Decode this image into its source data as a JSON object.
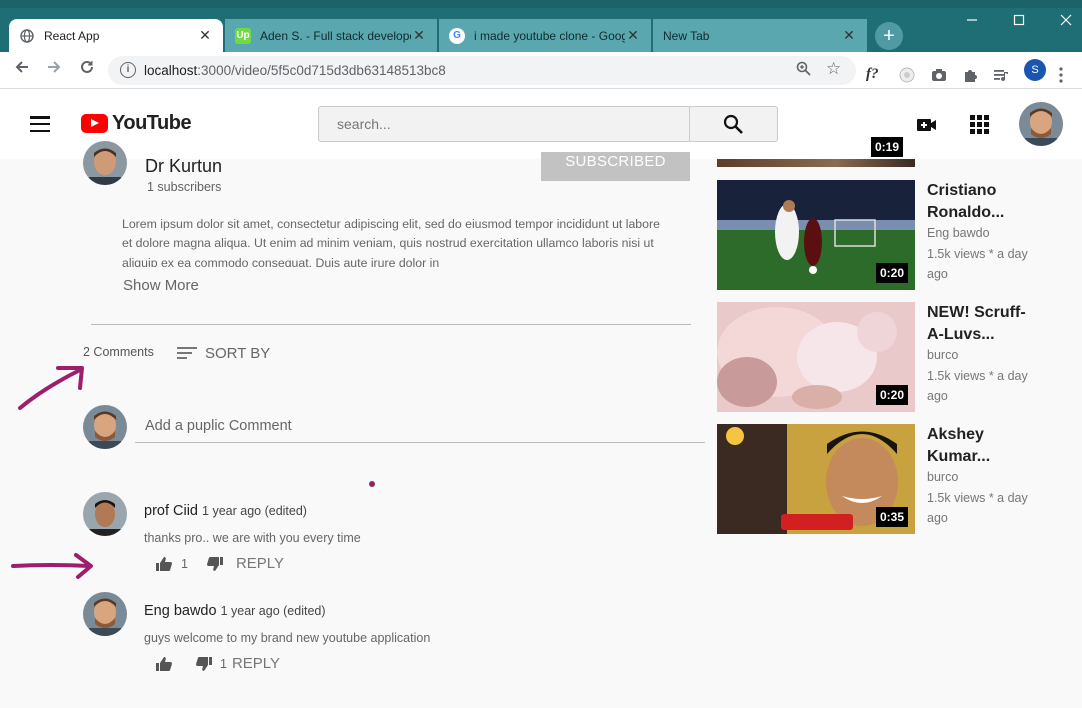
{
  "browser": {
    "tabs": [
      {
        "title": "React App",
        "close": "✕",
        "icon": "globe-icon"
      },
      {
        "title": "Aden S. - Full stack developer",
        "close": "✕",
        "icon": "upwork-icon",
        "badge": "Up"
      },
      {
        "title": "i made youtube clone - Google",
        "close": "✕",
        "icon": "google-icon",
        "badge": "G"
      },
      {
        "title": "New Tab",
        "close": "✕",
        "icon": "none"
      }
    ],
    "new_tab": "+",
    "address": {
      "host": "localhost",
      "path": ":3000/video/5f5c0d715d3db63148513bc8"
    },
    "profile_initial": "S",
    "ext_fq": "f?"
  },
  "header": {
    "logo_text": "YouTube",
    "search_placeholder": "search...",
    "logo_color": "#ff0000"
  },
  "channel": {
    "name": "Dr Kurtun",
    "subscribers": "1 subscribers",
    "subscribe_label": "SUBSCRIBED",
    "description": "Lorem ipsum dolor sit amet, consectetur adipiscing elit, sed do eiusmod tempor incididunt ut labore et dolore magna aliqua. Ut enim ad minim veniam, quis nostrud exercitation ullamco laboris nisi ut aliquip ex ea commodo consequat. Duis aute irure dolor in",
    "show_more": "Show More"
  },
  "comments": {
    "count_label": "2 Comments",
    "sort_label": "SORT BY",
    "add_placeholder": "Add a puplic Comment",
    "items": [
      {
        "author": "prof Ciid",
        "meta": "1 year ago (edited)",
        "text": "thanks pro.. we are with you every time",
        "likes": "1",
        "dislikes": "",
        "reply": "REPLY"
      },
      {
        "author": "Eng bawdo",
        "meta": "1 year ago (edited)",
        "text": "guys welcome to my brand new youtube application",
        "likes": "",
        "dislikes": "1",
        "reply": "REPLY"
      }
    ]
  },
  "sidebar": {
    "top_duration": "0:19",
    "videos": [
      {
        "title": "Cristiano Ronaldo...",
        "author": "Eng bawdo",
        "stats": "1.5k views * a day ago",
        "duration": "0:20"
      },
      {
        "title": "NEW! Scruff-A-Luvs...",
        "author": "burco",
        "stats": "1.5k views * a day ago",
        "duration": "0:20"
      },
      {
        "title": "Akshey Kumar...",
        "author": "burco",
        "stats": "1.5k views * a day ago",
        "duration": "0:35"
      }
    ]
  },
  "annotation_color": "#9b1f6e"
}
